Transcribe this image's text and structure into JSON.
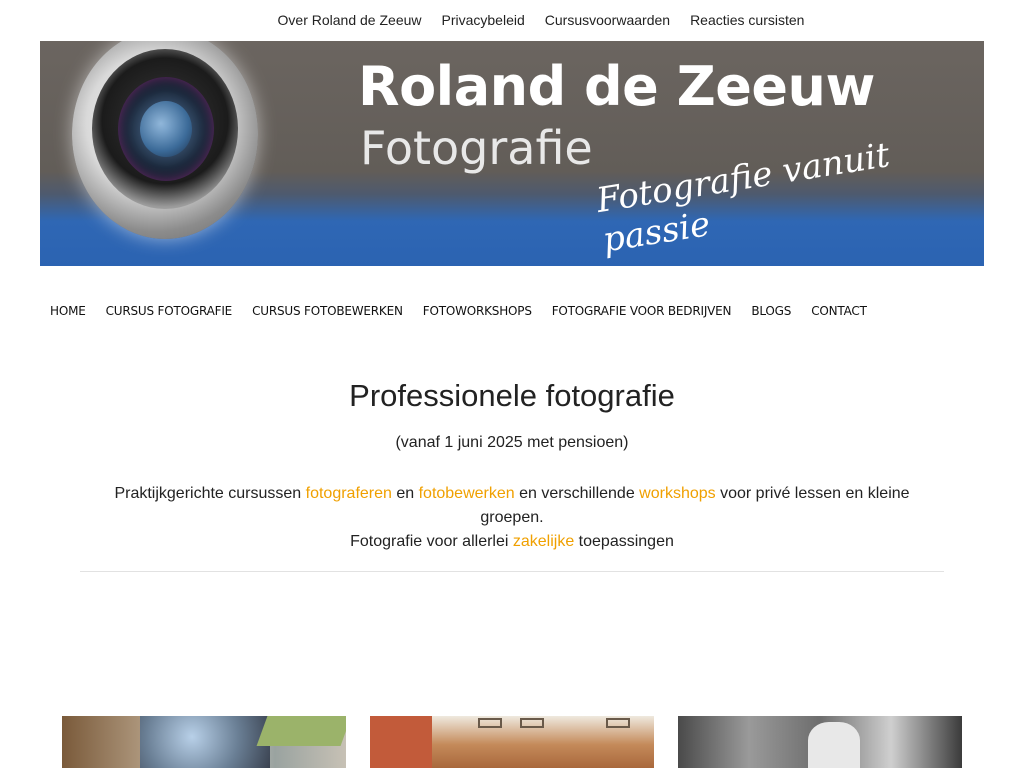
{
  "top_nav": {
    "items": [
      "Over Roland de Zeeuw",
      "Privacybeleid",
      "Cursusvoorwaarden",
      "Reacties cursisten"
    ]
  },
  "banner": {
    "title": "Roland de Zeeuw",
    "subtitle": "Fotografie",
    "tagline": "Fotografie vanuit passie"
  },
  "main_nav": {
    "items": [
      "HOME",
      "CURSUS FOTOGRAFIE",
      "CURSUS FOTOBEWERKEN",
      "FOTOWORKSHOPS",
      "FOTOGRAFIE VOOR BEDRIJVEN",
      "BLOGS",
      "CONTACT"
    ]
  },
  "content": {
    "heading": "Professionele fotografie",
    "subheading": "(vanaf 1 juni 2025 met pensioen)",
    "intro_1": "Praktijkgerichte cursussen ",
    "link_fotograferen": "fotograferen",
    "intro_2": " en ",
    "link_fotobewerken": "fotobewerken",
    "intro_3": " en verschillende ",
    "link_workshops": "workshops",
    "intro_4": " voor privé lessen en kleine groepen.",
    "intro_5": "Fotografie voor allerlei ",
    "link_zakelijke": "zakelijke",
    "intro_6": " toepassingen"
  },
  "colors": {
    "link": "#f0a000",
    "banner_top": "#625d58",
    "banner_bottom": "#2b63b2"
  }
}
